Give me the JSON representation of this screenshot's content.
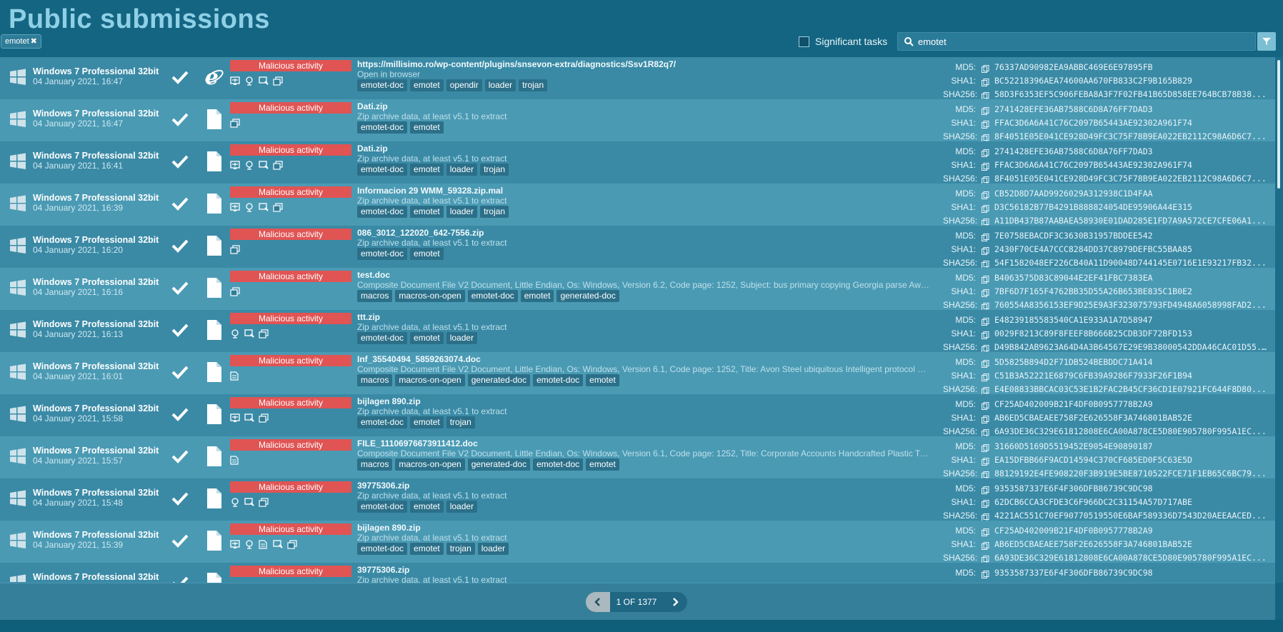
{
  "header": {
    "title": "Public submissions",
    "filter_chip": "emotet",
    "significant_label": "Significant tasks",
    "search_value": "emotet"
  },
  "colors": {
    "background": "#146481",
    "verdict_red": "#e05454",
    "title_color": "#8fd0e6",
    "tag_bg": "#2b6f88"
  },
  "icons": {
    "os": "windows-logo-icon",
    "status": "checkmark-icon",
    "url_type": "internet-explorer-icon",
    "file_type": "document-file-icon",
    "search": "search-icon",
    "filter": "filter-funnel-icon",
    "copy": "copy-icon"
  },
  "rows": [
    {
      "os": "Windows 7 Professional 32bit",
      "date": "04 January 2021, 16:47",
      "type": "url",
      "verdict": "Malicious activity",
      "name": "https://millisimo.ro/wp-content/plugins/snsevon-extra/diagnostics/Ssv1R82q7/",
      "desc": "Open in browser",
      "tags": [
        "emotet-doc",
        "emotet",
        "opendir",
        "loader",
        "trojan"
      ],
      "icons": [
        "net",
        "net2",
        "proc",
        "win"
      ],
      "md5": "76337AD90982EA9ABBC469E6E97895FB",
      "sha1": "BC52218396AEA74600AA670FB833C2F9B165B829",
      "sha256": "58D3F6353EF5C906FEBA8A3F7F02FB41B65D858EE764BCB78B38..."
    },
    {
      "os": "Windows 7 Professional 32bit",
      "date": "04 January 2021, 16:47",
      "type": "file",
      "verdict": "Malicious activity",
      "name": "Dati.zip",
      "desc": "Zip archive data, at least v5.1 to extract",
      "tags": [
        "emotet-doc",
        "emotet"
      ],
      "icons": [
        "win"
      ],
      "md5": "2741428EFE36AB7588C6D8A76FF7DAD3",
      "sha1": "FFAC3D6A6A41C76C2097B65443AE92302A961F74",
      "sha256": "8F4051E05E041CE928D49FC3C75F78B9EA022EB2112C98A6D6C7..."
    },
    {
      "os": "Windows 7 Professional 32bit",
      "date": "04 January 2021, 16:41",
      "type": "file",
      "verdict": "Malicious activity",
      "name": "Dati.zip",
      "desc": "Zip archive data, at least v5.1 to extract",
      "tags": [
        "emotet-doc",
        "emotet",
        "loader",
        "trojan"
      ],
      "icons": [
        "net",
        "net2",
        "proc",
        "win"
      ],
      "md5": "2741428EFE36AB7588C6D8A76FF7DAD3",
      "sha1": "FFAC3D6A6A41C76C2097B65443AE92302A961F74",
      "sha256": "8F4051E05E041CE928D49FC3C75F78B9EA022EB2112C98A6D6C7..."
    },
    {
      "os": "Windows 7 Professional 32bit",
      "date": "04 January 2021, 16:39",
      "type": "file",
      "verdict": "Malicious activity",
      "name": "Informacion 29 WMM_59328.zip.mal",
      "desc": "Zip archive data, at least v5.1 to extract",
      "tags": [
        "emotet-doc",
        "emotet",
        "loader",
        "trojan"
      ],
      "icons": [
        "net",
        "net2",
        "proc",
        "win"
      ],
      "md5": "CB52D8D7AAD9926029A312938C1D4FAA",
      "sha1": "D3C56182B77B4291B888824054DE95906A44E315",
      "sha256": "A11DB437B87AABAEA58930E01DAD285E1FD7A9A572CE7CFE06A1..."
    },
    {
      "os": "Windows 7 Professional 32bit",
      "date": "04 January 2021, 16:20",
      "type": "file",
      "verdict": "Malicious activity",
      "name": "086_3012_122020_642-7556.zip",
      "desc": "Zip archive data, at least v5.1 to extract",
      "tags": [
        "emotet-doc",
        "emotet"
      ],
      "icons": [
        "win"
      ],
      "md5": "7E0758EBACDF3C3630B31957BDDEE542",
      "sha1": "2430F70CE4A7CCC8284DD37C8979DEFBC55BAA85",
      "sha256": "54F1582048EF226CB40A11D90048D744145E0716E1E93217FB32..."
    },
    {
      "os": "Windows 7 Professional 32bit",
      "date": "04 January 2021, 16:16",
      "type": "file",
      "verdict": "Malicious activity",
      "name": "test.doc",
      "desc": "Composite Document File V2 Document, Little Endian, Os: Windows, Version 6.2, Code page: 1252, Subject: bus primary copying Georgia parse Aweso...",
      "tags": [
        "macros",
        "macros-on-open",
        "emotet-doc",
        "emotet",
        "generated-doc"
      ],
      "icons": [
        "win"
      ],
      "md5": "B4063575D83C89044E2EF41FBC7383EA",
      "sha1": "7BF6D7F165F4762BB35D55A26B653BE835C1B0E2",
      "sha256": "760554A8356153EF9D25E9A3F323075793FD4948A6058998FAD2..."
    },
    {
      "os": "Windows 7 Professional 32bit",
      "date": "04 January 2021, 16:13",
      "type": "file",
      "verdict": "Malicious activity",
      "name": "ttt.zip",
      "desc": "Zip archive data, at least v5.1 to extract",
      "tags": [
        "emotet-doc",
        "emotet",
        "loader"
      ],
      "icons": [
        "net2",
        "proc",
        "win"
      ],
      "md5": "E48239185583540CA1E933A1A7D58947",
      "sha1": "0029F8213C89F8FEEF8B666B25CDB3DF72BFD153",
      "sha256": "D49B842AB9623A64D4A3B64567E29E9B38000542DDA46CAC01D55..."
    },
    {
      "os": "Windows 7 Professional 32bit",
      "date": "04 January 2021, 16:01",
      "type": "file",
      "verdict": "Malicious activity",
      "name": "Inf_35540494_5859263074.doc",
      "desc": "Composite Document File V2 Document, Little Endian, Os: Windows, Version 6.1, Code page: 1252, Title: Avon Steel ubiquitous Intelligent protocol Con...",
      "tags": [
        "macros",
        "macros-on-open",
        "generated-doc",
        "emotet-doc",
        "emotet"
      ],
      "icons": [
        "doc"
      ],
      "md5": "5D5825B894D2F71DB524BEBDDC71A414",
      "sha1": "C51B3A52221E6879C6FB39A9286F7933F26F1B94",
      "sha256": "E4E08833BBCAC03C53E1B2FAC2B45CF36CD1E07921FC644F8D80..."
    },
    {
      "os": "Windows 7 Professional 32bit",
      "date": "04 January 2021, 15:58",
      "type": "file",
      "verdict": "Malicious activity",
      "name": "bijlagen 890.zip",
      "desc": "Zip archive data, at least v5.1 to extract",
      "tags": [
        "emotet-doc",
        "emotet",
        "trojan"
      ],
      "icons": [
        "net",
        "proc",
        "win"
      ],
      "md5": "CF25AD402009B21F4DF0B0957778B2A9",
      "sha1": "AB6ED5CBAEAEE758F2E626558F3A746801BAB52E",
      "sha256": "6A93DE36C329E61812808E6CA00A878CE5D80E905780F995A1EC..."
    },
    {
      "os": "Windows 7 Professional 32bit",
      "date": "04 January 2021, 15:57",
      "type": "file",
      "verdict": "Malicious activity",
      "name": "FILE_11106976673911412.doc",
      "desc": "Composite Document File V2 Document, Little Endian, Os: Windows, Version 6.1, Code page: 1252, Title: Corporate Accounts Handcrafted Plastic Tun...",
      "tags": [
        "macros",
        "macros-on-open",
        "generated-doc",
        "emotet-doc",
        "emotet"
      ],
      "icons": [
        "doc"
      ],
      "md5": "31660D5169D5519452E9054E90890187",
      "sha1": "EA15DFBB66F9ACD14594C370CF685ED0F5C63E5D",
      "sha256": "88129192E4FE908220F3B919E5BE8710522FCE71F1EB65C6BC79..."
    },
    {
      "os": "Windows 7 Professional 32bit",
      "date": "04 January 2021, 15:48",
      "type": "file",
      "verdict": "Malicious activity",
      "name": "39775306.zip",
      "desc": "Zip archive data, at least v5.1 to extract",
      "tags": [
        "emotet-doc",
        "emotet",
        "loader"
      ],
      "icons": [
        "net2",
        "proc",
        "win"
      ],
      "md5": "9353587337E6F4F306DFB86739C9DC98",
      "sha1": "62DCB6CCA3CFDE3C6F966DC2C31154A57D717ABE",
      "sha256": "4221AC551C70EF90770519550E6BAF589336D7543D20AEEAACED..."
    },
    {
      "os": "Windows 7 Professional 32bit",
      "date": "04 January 2021, 15:39",
      "type": "file",
      "verdict": "Malicious activity",
      "name": "bijlagen 890.zip",
      "desc": "Zip archive data, at least v5.1 to extract",
      "tags": [
        "emotet-doc",
        "emotet",
        "trojan",
        "loader"
      ],
      "icons": [
        "net",
        "net2",
        "doc",
        "proc",
        "win"
      ],
      "md5": "CF25AD402009B21F4DF0B0957778B2A9",
      "sha1": "AB6ED5CBAEAEE758F2E626558F3A746801BAB52E",
      "sha256": "6A93DE36C329E61812808E6CA00A878CE5D80E905780F995A1EC..."
    },
    {
      "os": "Windows 7 Professional 32bit",
      "date": "",
      "type": "file",
      "verdict": "Malicious activity",
      "name": "39775306.zip",
      "desc": "Zip archive data, at least v5.1 to extract",
      "tags": [],
      "icons": [],
      "md5": "9353587337E6F4F306DFB86739C9DC98",
      "sha1": "",
      "sha256": ""
    }
  ],
  "hash_labels": {
    "md5": "MD5:",
    "sha1": "SHA1:",
    "sha256": "SHA256:"
  },
  "pagination": {
    "label": "1 OF 1377"
  }
}
